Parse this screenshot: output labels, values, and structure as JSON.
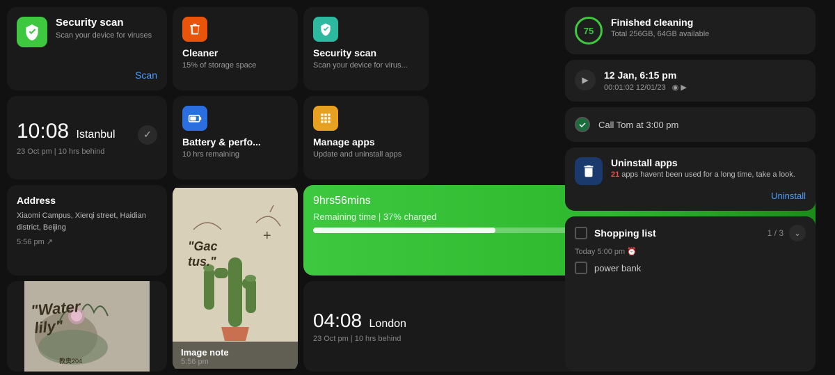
{
  "security_main": {
    "title": "Security scan",
    "subtitle": "Scan your device for viruses",
    "scan_label": "Scan"
  },
  "clock_istanbul": {
    "time": "10:08",
    "city": "Istanbul",
    "detail": "23 Oct pm | 10 hrs behind"
  },
  "address": {
    "title": "Address",
    "lines": "Xiaomi Campus, Xierqi street, Haidian district, Beijing",
    "time": "5:56 pm"
  },
  "image_note": {
    "title": "Image note",
    "time": "5:56 pm"
  },
  "cleaner": {
    "title": "Cleaner",
    "subtitle": "15% of storage space"
  },
  "security_scan_small": {
    "title": "Security scan",
    "subtitle": "Scan your device for virus..."
  },
  "battery_perf": {
    "title": "Battery & perfo...",
    "subtitle": "10 hrs remaining"
  },
  "manage_apps": {
    "title": "Manage apps",
    "subtitle": "Update and uninstall apps"
  },
  "battery_big": {
    "hours": "9",
    "hours_unit": "hrs",
    "mins": "56",
    "mins_unit": "mins",
    "remaining_label": "Remaining time | 37% charged",
    "percent": 37
  },
  "london_clock": {
    "time": "04:08",
    "city": "London",
    "detail": "23 Oct pm | 10 hrs behind"
  },
  "finished_cleaning": {
    "badge": "75",
    "title": "Finished cleaning",
    "subtitle": "Total 256GB, 64GB available"
  },
  "recording": {
    "title": "12 Jan, 6:15 pm",
    "subtitle": "00:01:02  12/01/23"
  },
  "call_tom": {
    "title": "Call Tom at 3:00 pm"
  },
  "uninstall": {
    "title": "Uninstall apps",
    "count": "21",
    "description": " apps havent been used for a long time, take a look.",
    "button_label": "Uninstall"
  },
  "shopping": {
    "title": "Shopping list",
    "count": "1 / 3",
    "time": "Today 5:00 pm",
    "item": "power bank"
  }
}
